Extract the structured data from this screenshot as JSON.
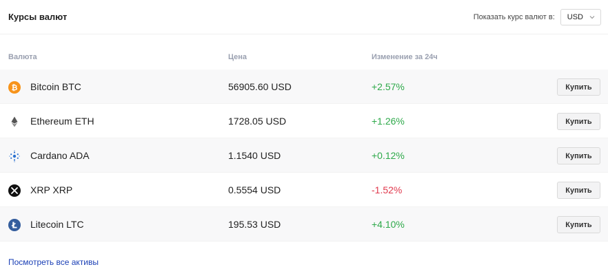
{
  "header": {
    "title": "Курсы валют",
    "currency_label": "Показать курс валют в:",
    "currency_selected": "USD"
  },
  "columns": {
    "currency": "Валюта",
    "price": "Цена",
    "change": "Изменение за 24ч"
  },
  "rows": [
    {
      "name": "Bitcoin BTC",
      "price": "56905.60 USD",
      "change": "+2.57%",
      "buy_label": "Купить",
      "icon": "bitcoin-icon"
    },
    {
      "name": "Ethereum ETH",
      "price": "1728.05 USD",
      "change": "+1.26%",
      "buy_label": "Купить",
      "icon": "ethereum-icon"
    },
    {
      "name": "Cardano ADA",
      "price": "1.1540 USD",
      "change": "+0.12%",
      "buy_label": "Купить",
      "icon": "cardano-icon"
    },
    {
      "name": "XRP XRP",
      "price": "0.5554 USD",
      "change": "-1.52%",
      "buy_label": "Купить",
      "icon": "xrp-icon"
    },
    {
      "name": "Litecoin LTC",
      "price": "195.53 USD",
      "change": "+4.10%",
      "buy_label": "Купить",
      "icon": "litecoin-icon"
    }
  ],
  "footer": {
    "view_all_label": "Посмотреть все активы"
  },
  "colors": {
    "positive": "#2ea94a",
    "negative": "#e0384c",
    "link": "#1a3fb5",
    "bitcoin": "#f7931a",
    "litecoin": "#345d9d"
  }
}
